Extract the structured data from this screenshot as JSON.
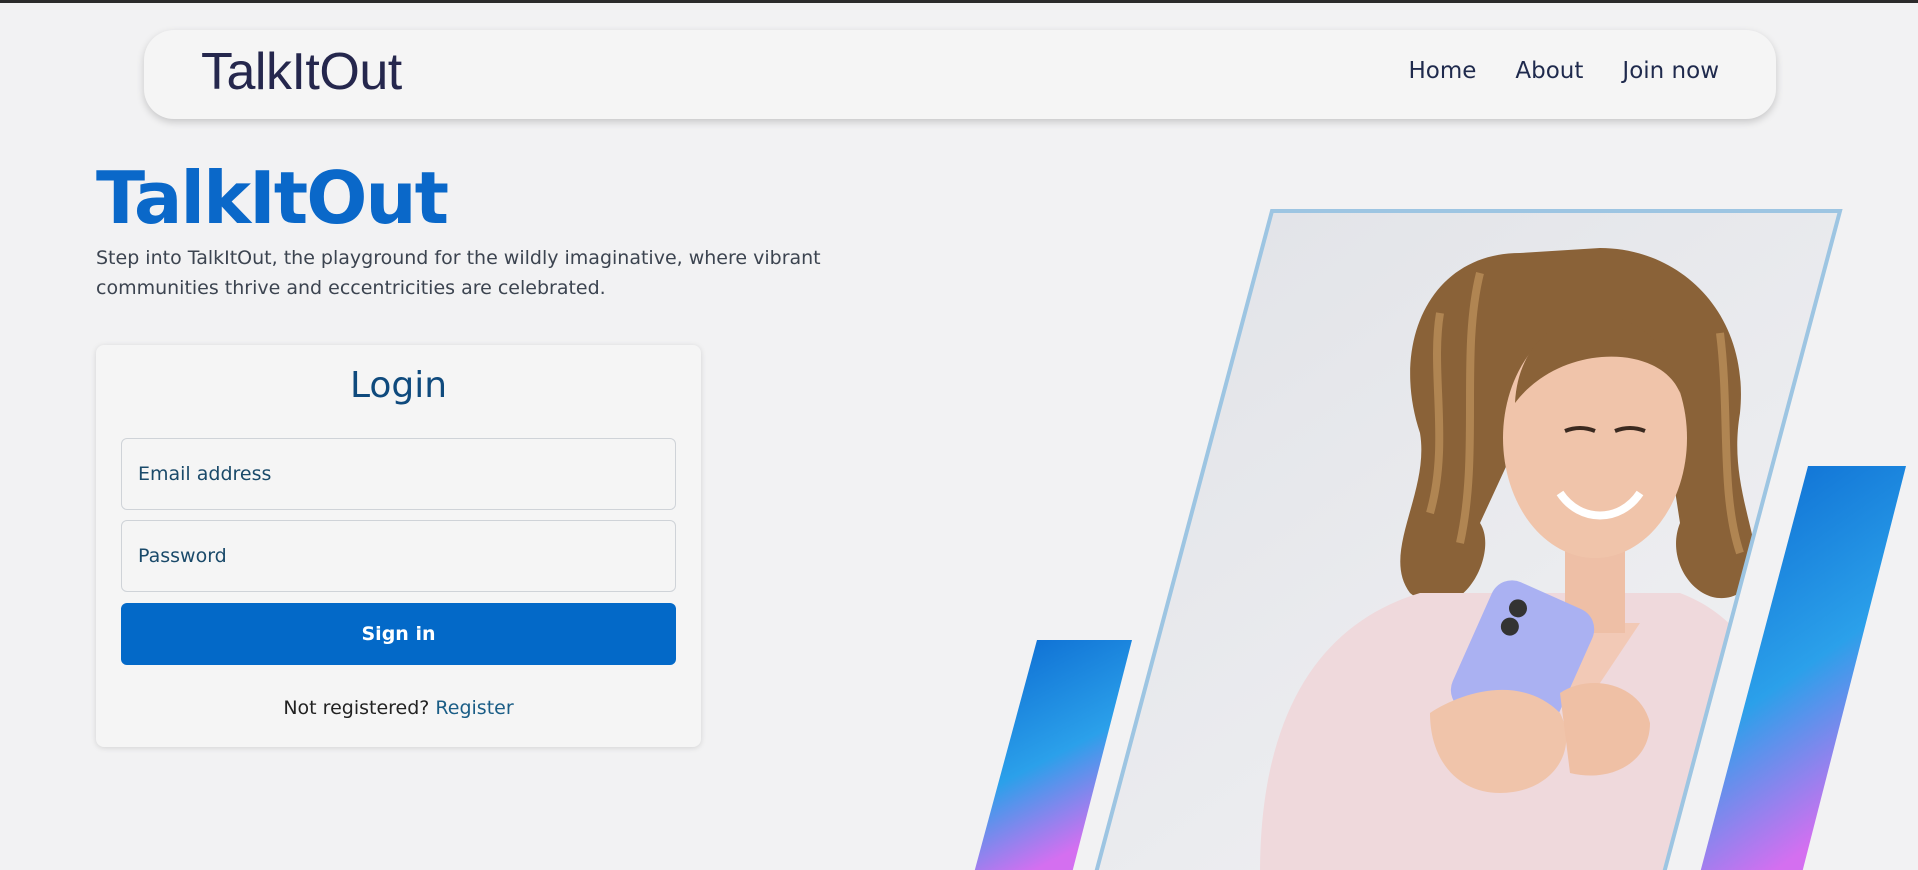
{
  "nav": {
    "brand": "TalkItOut",
    "links": [
      "Home",
      "About",
      "Join now"
    ]
  },
  "hero": {
    "title": "TalkItOut",
    "description": "Step into TalkItOut, the playground for the wildly imaginative, where vibrant communities thrive and eccentricities are celebrated."
  },
  "login": {
    "title": "Login",
    "email_placeholder": "Email address",
    "password_placeholder": "Password",
    "signin_label": "Sign in",
    "not_registered": "Not registered?",
    "register_link": "Register"
  },
  "colors": {
    "accent": "#0a68c9",
    "button": "#0369c8",
    "gradient_top": "#0a68d0",
    "gradient_mid": "#2ba0ea",
    "gradient_bottom": "#d46ff0"
  },
  "icons": [
    "woman-with-phone-photo"
  ]
}
